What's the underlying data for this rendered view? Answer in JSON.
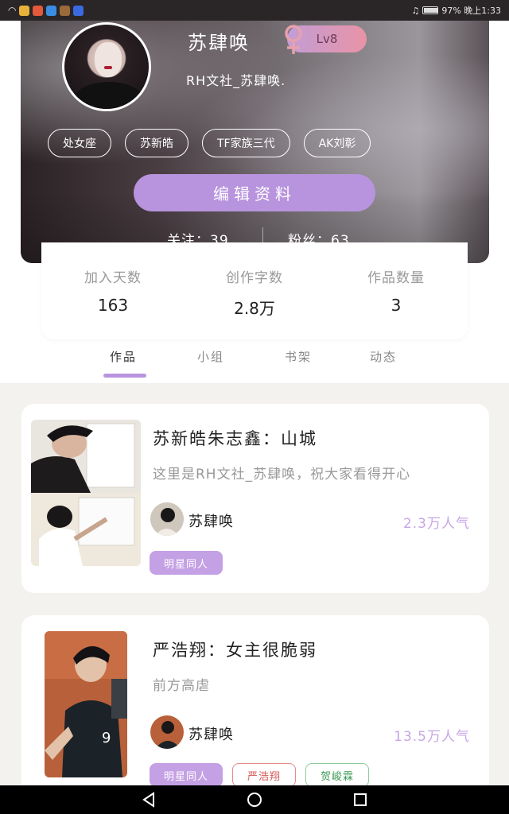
{
  "status_bar": {
    "right_text": "97% 晚上1:33"
  },
  "profile": {
    "username": "苏肆唤",
    "level": "Lv8",
    "signature": "RH文社_苏肆唤.",
    "tags": [
      "处女座",
      "苏新皓",
      "TF家族三代",
      "AK刘彰"
    ],
    "edit_button_label": "编辑资料",
    "following_text": "关注：39",
    "followers_text": "粉丝：63"
  },
  "stats": [
    {
      "label": "加入天数",
      "value": "163"
    },
    {
      "label": "创作字数",
      "value": "2.8万"
    },
    {
      "label": "作品数量",
      "value": "3"
    }
  ],
  "tabs": [
    "作品",
    "小组",
    "书架",
    "动态"
  ],
  "works": [
    {
      "title": "苏新皓朱志鑫：山城",
      "description": "这里是RH文社_苏肆唤，祝大家看得开心",
      "author": "苏肆唤",
      "popularity": "2.3万人气",
      "tags": [
        {
          "label": "明星同人",
          "style": "purple"
        }
      ]
    },
    {
      "title": "严浩翔：女主很脆弱",
      "description": "前方高虐",
      "author": "苏肆唤",
      "popularity": "13.5万人气",
      "tags": [
        {
          "label": "明星同人",
          "style": "purple"
        },
        {
          "label": "严浩翔",
          "style": "red"
        },
        {
          "label": "贺峻霖",
          "style": "green"
        }
      ]
    }
  ],
  "colors": {
    "accent": "#b894de",
    "popularity": "#c7a6e6"
  }
}
